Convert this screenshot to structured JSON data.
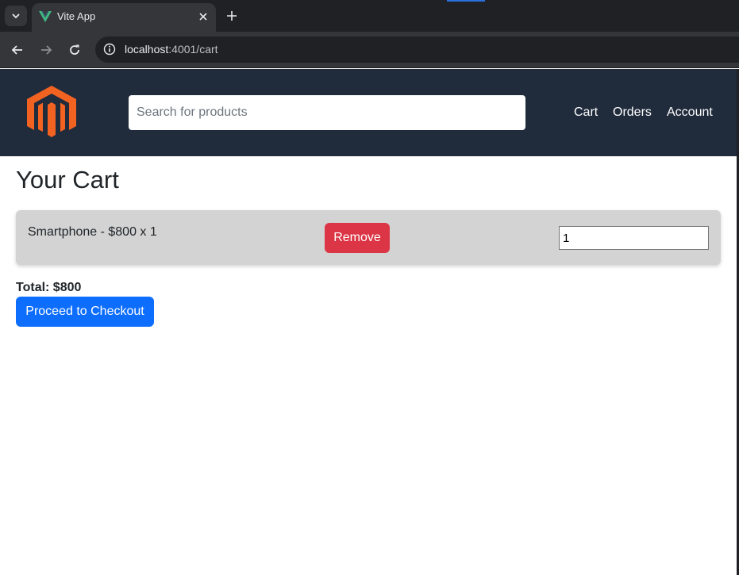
{
  "browser": {
    "tab_title": "Vite App",
    "url_host": "localhost",
    "url_path": ":4001/cart"
  },
  "header": {
    "search_placeholder": "Search for products",
    "nav": {
      "cart": "Cart",
      "orders": "Orders",
      "account": "Account"
    }
  },
  "main": {
    "title": "Your Cart",
    "items": [
      {
        "label": "Smartphone - $800 x 1",
        "remove_label": "Remove",
        "quantity": "1"
      }
    ],
    "total": "Total: $800",
    "checkout_label": "Proceed to Checkout"
  },
  "colors": {
    "header_bg": "#202b3c",
    "logo": "#f26322",
    "remove": "#dc3545",
    "checkout": "#0d6efd",
    "cart_item_bg": "#d3d3d3"
  },
  "icons": {
    "favicon": "vue-logo-icon",
    "logo": "magento-logo-icon"
  }
}
